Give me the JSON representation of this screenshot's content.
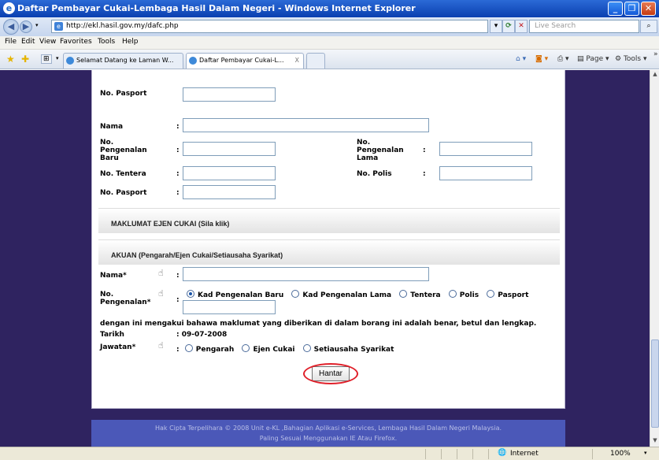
{
  "window": {
    "title": "Daftar Pembayar Cukai-Lembaga Hasil Dalam Negeri - Windows Internet Explorer"
  },
  "address": {
    "url": "http://ekl.hasil.gov.my/dafc.php",
    "search_placeholder": "Live Search"
  },
  "menu": [
    "File",
    "Edit",
    "View",
    "Favorites",
    "Tools",
    "Help"
  ],
  "tabs": [
    {
      "label": "Selamat Datang ke Laman W..."
    },
    {
      "label": "Daftar Pembayar Cukai-L...",
      "close": "X"
    }
  ],
  "command_bar": {
    "page": "Page",
    "tools": "Tools"
  },
  "form": {
    "top": {
      "pasport_label": "No. Pasport"
    },
    "nama_label": "Nama",
    "colon": ":",
    "kp_baru_label": "No. Pengenalan Baru",
    "kp_lama_label": "No. Pengenalan Lama",
    "tentera_label": "No. Tentera",
    "polis_label": "No. Polis",
    "pasport_label": "No. Pasport",
    "section_ejen": "MAKLUMAT EJEN CUKAI (Sila klik)",
    "section_akuan": "AKUAN (Pengarah/Ejen Cukai/Setiausaha Syarikat)",
    "akuan_nama_label": "Nama*",
    "akuan_pengenalan_label": "No. Pengenalan*",
    "pengenalan_options": [
      "Kad Pengenalan Baru",
      "Kad Pengenalan Lama",
      "Tentera",
      "Polis",
      "Pasport"
    ],
    "pengenalan_selected": "Kad Pengenalan Baru",
    "declaration": "dengan ini mengakui bahawa maklumat yang diberikan di dalam borang ini adalah benar, betul dan lengkap.",
    "tarikh_label": "Tarikh",
    "tarikh_value": ": 09-07-2008",
    "jawatan_label": "Jawatan*",
    "jawatan_options": [
      "Pengarah",
      "Ejen Cukai",
      "Setiausaha Syarikat"
    ],
    "submit_label": "Hantar"
  },
  "footer": {
    "line1": "Hak Cipta Terpelihara © 2008 Unit e-KL ,Bahagian Aplikasi e-Services, Lembaga Hasil Dalam Negeri Malaysia.",
    "line2": "Paling Sesuai Menggunakan IE Atau Firefox."
  },
  "status": {
    "zone": "Internet",
    "zoom": "100%"
  }
}
